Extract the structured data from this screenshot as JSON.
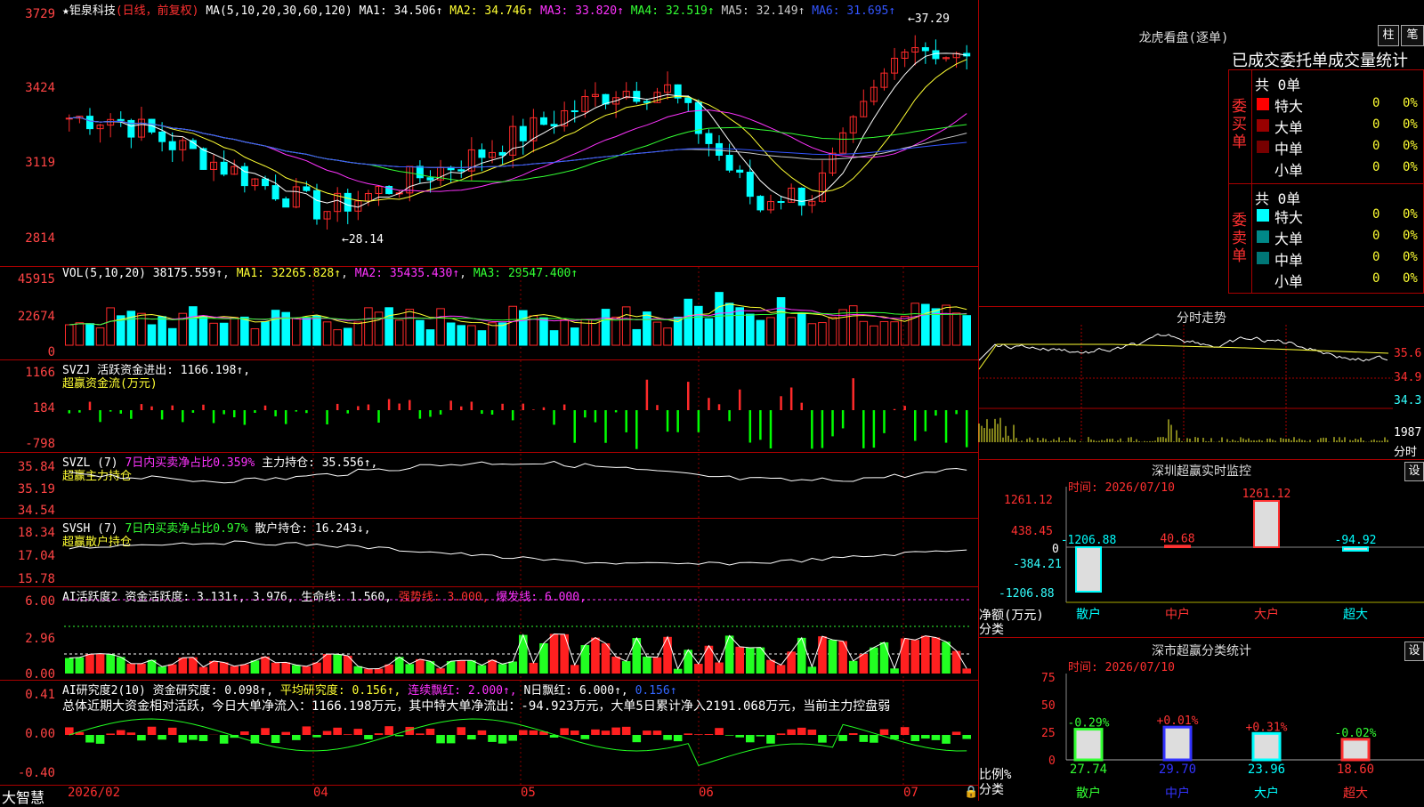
{
  "stock": {
    "name": "★钜泉科技",
    "mode": "(日线，前复权)",
    "ma_params": "MA(5,10,20,30,60,120)",
    "ma": [
      {
        "label": "MA1: 34.506↑",
        "color": "#ffffff"
      },
      {
        "label": "MA2: 34.746↑",
        "color": "#ffff33"
      },
      {
        "label": "MA3: 33.820↑",
        "color": "#ff33ff"
      },
      {
        "label": "MA4: 32.519↑",
        "color": "#33ff33"
      },
      {
        "label": "MA5: 32.149↑",
        "color": "#cccccc"
      },
      {
        "label": "MA6: 31.695↑",
        "color": "#3355ff"
      }
    ],
    "high_mark": "37.29",
    "low_mark": "28.14",
    "y_ticks": [
      "3729",
      "3424",
      "3119",
      "2814"
    ]
  },
  "vol": {
    "params": "VOL(5,10,20)",
    "value": "38175.559↑",
    "ma1": "MA1: 32265.828↑",
    "ma2": "MA2: 35435.430↑",
    "ma3": "MA3: 29547.400↑",
    "y_ticks": [
      "45915",
      "22674",
      "0"
    ]
  },
  "svzj": {
    "title": "SVZJ  活跃资金进出: 1166.198↑,",
    "subtitle": "超赢资金流(万元)",
    "y_ticks": [
      "1166",
      "184",
      "-798"
    ]
  },
  "svzl": {
    "title_a": "SVZL (7)",
    "title_b": "7日内买卖净占比0.359%",
    "title_c": "主力持仓: 35.556↑,",
    "subtitle": "超赢主力持仓",
    "y_ticks": [
      "35.84",
      "35.19",
      "34.54"
    ]
  },
  "svsh": {
    "title_a": "SVSH (7)",
    "title_b": "7日内买卖净占比0.97%",
    "title_c": "散户持仓: 16.243↓,",
    "subtitle": "超赢散户持仓",
    "y_ticks": [
      "18.34",
      "17.04",
      "15.78"
    ]
  },
  "ai_active": {
    "a": "AI活跃度2",
    "b": "资金活跃度: 3.131↑,",
    "c": "3.976,",
    "d": "生命线: 1.560,",
    "e": "强势线: 3.000,",
    "f": "爆发线: 6.000,",
    "y_ticks": [
      "6.00",
      "2.96",
      "0.00"
    ]
  },
  "ai_research": {
    "a": "AI研究度2(10)",
    "b": "资金研究度: 0.098↑,",
    "c": "平均研究度: 0.156↑,",
    "d": "连续飘红: 2.000↑,",
    "e": "N日飘红: 6.000↑,",
    "f": "0.156↑",
    "summary": "总体近期大资金相对活跃，今日大单净流入：1166.198万元，其中特大单净流出：-94.923万元，大单5日累计净入2191.068万元，当前主力控盘弱",
    "y_ticks": [
      "0.41",
      "0.00",
      "-0.40"
    ]
  },
  "xaxis": {
    "labels": [
      "2026/02",
      "04",
      "05",
      "06",
      "07"
    ],
    "brand": "大智慧"
  },
  "dragon": {
    "title": "龙虎看盘(逐单)",
    "btn1": "柱",
    "btn2": "笔",
    "tabs": "已成交委托单成交量统计",
    "buy_side": "委买单",
    "sell_side": "委卖单",
    "buy_total": "共 0单",
    "sell_total": "共 0单",
    "buy_rows": [
      {
        "name": "特大",
        "v": "0",
        "p": "0%",
        "color": "#ff0000"
      },
      {
        "name": "大单",
        "v": "0",
        "p": "0%",
        "color": "#990000"
      },
      {
        "name": "中单",
        "v": "0",
        "p": "0%",
        "color": "#770000"
      },
      {
        "name": "小单",
        "v": "0",
        "p": "0%",
        "color": ""
      }
    ],
    "sell_rows": [
      {
        "name": "特大",
        "v": "0",
        "p": "0%",
        "color": "#00ffff"
      },
      {
        "name": "大单",
        "v": "0",
        "p": "0%",
        "color": "#008888"
      },
      {
        "name": "中单",
        "v": "0",
        "p": "0%",
        "color": "#007777"
      },
      {
        "name": "小单",
        "v": "0",
        "p": "0%",
        "color": ""
      }
    ]
  },
  "minute": {
    "title": "分时走势",
    "p1": "35.6",
    "p2": "34.9",
    "p3": "34.3",
    "vol": "1987",
    "unit": "分时"
  },
  "szmonitor": {
    "title": "深圳超赢实时监控",
    "btn": "设",
    "time": "时间: 2026/07/10",
    "y_ticks": [
      "1261.12",
      "438.45",
      "0",
      "-384.21",
      "-1206.88"
    ],
    "net_label": "净额(万元)",
    "cls_label": "分类",
    "bars": [
      {
        "name": "散户",
        "value": -1206.88,
        "label": "-1206.88",
        "color": "#00ffff"
      },
      {
        "name": "中户",
        "value": 40.68,
        "label": "40.68",
        "color": "#ff3333"
      },
      {
        "name": "大户",
        "value": 1261.12,
        "label": "1261.12",
        "color": "#ff3333"
      },
      {
        "name": "超大",
        "value": -94.92,
        "label": "-94.92",
        "color": "#00ffff"
      }
    ]
  },
  "szstat": {
    "title": "深市超赢分类统计",
    "btn": "设",
    "time": "时间: 2026/07/10",
    "y_ticks": [
      "75",
      "50",
      "25",
      "0"
    ],
    "ratio_label": "比例%",
    "cls_label": "分类",
    "bars": [
      {
        "name": "散户",
        "value": 27.74,
        "label": "27.74",
        "chg": "-0.29%",
        "color": "#33ff33",
        "chgcolor": "#33ff33"
      },
      {
        "name": "中户",
        "value": 29.7,
        "label": "29.70",
        "chg": "+0.01%",
        "color": "#3333ff",
        "chgcolor": "#ff3333"
      },
      {
        "name": "大户",
        "value": 23.96,
        "label": "23.96",
        "chg": "+0.31%",
        "color": "#00ffff",
        "chgcolor": "#ff3333"
      },
      {
        "name": "超大",
        "value": 18.6,
        "label": "18.60",
        "chg": "-0.02%",
        "color": "#ff3333",
        "chgcolor": "#33ff33"
      }
    ]
  }
}
